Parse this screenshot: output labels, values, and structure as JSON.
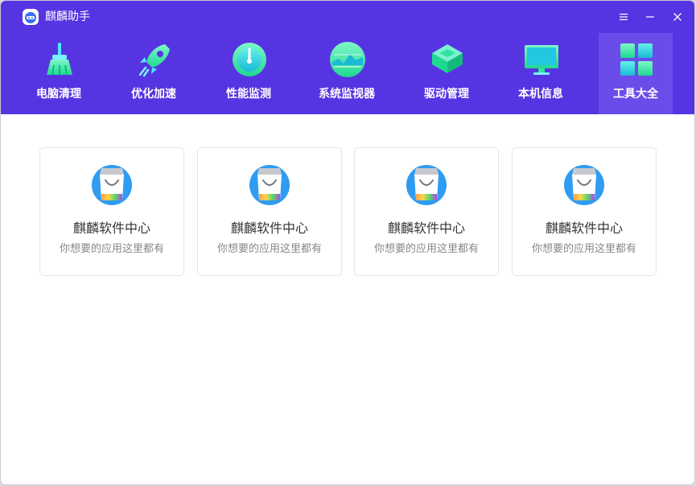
{
  "window": {
    "title": "麒麟助手",
    "controls": [
      "menu-icon",
      "minimize-icon",
      "close-icon"
    ]
  },
  "nav": {
    "items": [
      {
        "label": "电脑清理",
        "icon": "broom-icon",
        "active": false
      },
      {
        "label": "优化加速",
        "icon": "rocket-icon",
        "active": false
      },
      {
        "label": "性能监测",
        "icon": "gauge-icon",
        "active": false
      },
      {
        "label": "系统监视器",
        "icon": "monitor-wave-icon",
        "active": false
      },
      {
        "label": "驱动管理",
        "icon": "chip-icon",
        "active": false
      },
      {
        "label": "本机信息",
        "icon": "computer-icon",
        "active": false
      },
      {
        "label": "工具大全",
        "icon": "grid-icon",
        "active": true
      }
    ]
  },
  "tools": [
    {
      "title": "麒麟软件中心",
      "desc": "你想要的应用这里都有",
      "icon": "shopping-bag-icon"
    },
    {
      "title": "麒麟软件中心",
      "desc": "你想要的应用这里都有",
      "icon": "shopping-bag-icon"
    },
    {
      "title": "麒麟软件中心",
      "desc": "你想要的应用这里都有",
      "icon": "shopping-bag-icon"
    },
    {
      "title": "麒麟软件中心",
      "desc": "你想要的应用这里都有",
      "icon": "shopping-bag-icon"
    }
  ],
  "colors": {
    "header_bg": "#5634e2",
    "active_tab_bg": "#6a4cea",
    "icon_green": "#2fe3a0",
    "icon_cyan": "#22c7e0",
    "card_border": "#e6e6e9"
  }
}
